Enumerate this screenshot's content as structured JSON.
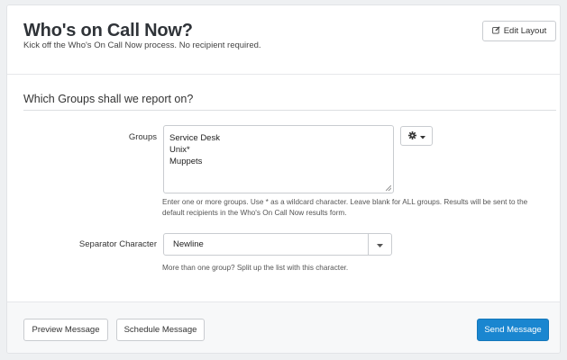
{
  "header": {
    "title": "Who's on Call Now?",
    "subtitle": "Kick off the Who's On Call Now process. No recipient required.",
    "edit_layout_label": "Edit Layout",
    "edit_icon": "pencil-square-icon"
  },
  "section": {
    "title": "Which Groups shall we report on?"
  },
  "groups_field": {
    "label": "Groups",
    "lines": [
      "Service Desk",
      "Unix*",
      "Muppets"
    ],
    "options_icon": "gear-icon",
    "help_line1": "Enter one or more groups. Use * as a wildcard character. Leave blank for ALL groups. Results will be sent to the",
    "help_line2": "default recipients in the Who's On Call Now results form."
  },
  "separator_field": {
    "label": "Separator Character",
    "selected": "Newline",
    "help": "More than one group? Split up the list with this character."
  },
  "footer": {
    "preview_label": "Preview Message",
    "schedule_label": "Schedule Message",
    "send_label": "Send Message"
  },
  "colors": {
    "primary": "#1a86d0",
    "background": "#eef0f2"
  }
}
